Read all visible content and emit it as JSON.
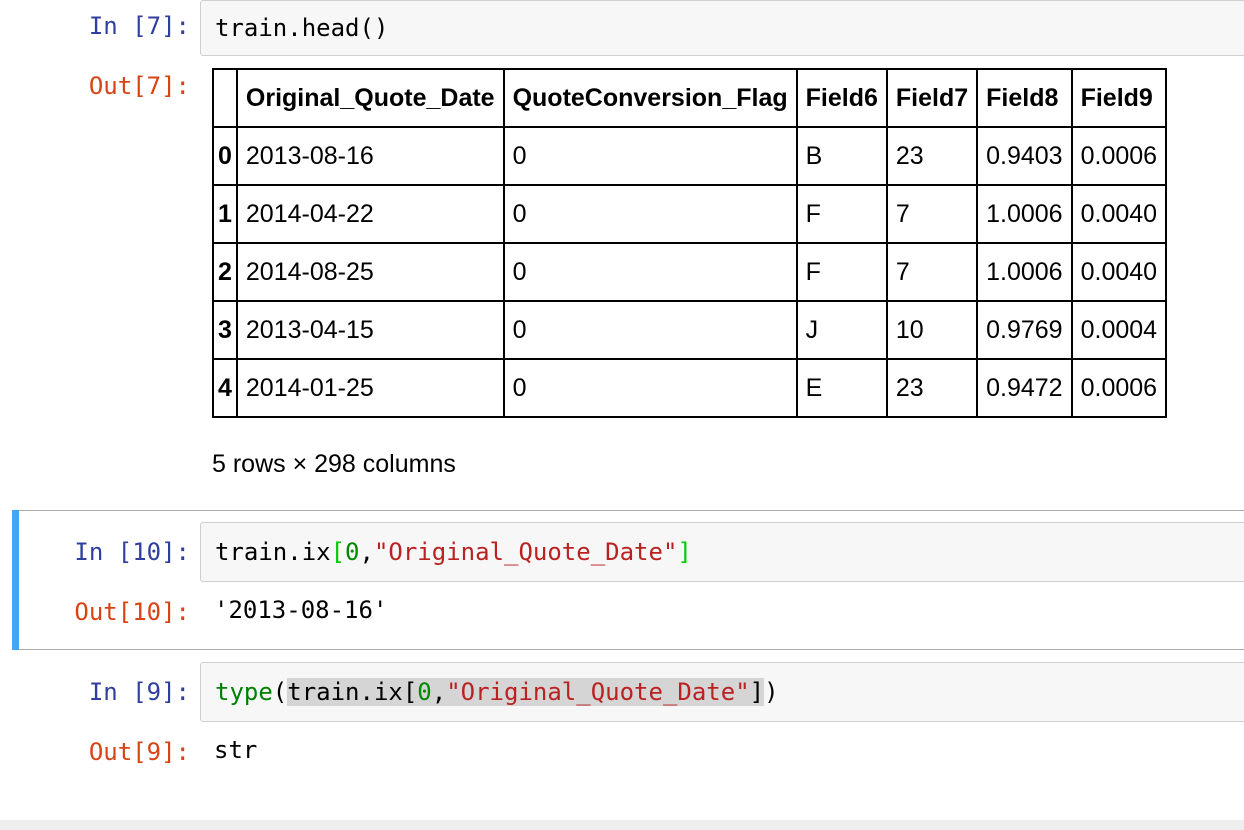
{
  "cells": [
    {
      "in_prompt": "In [7]:",
      "code": "train.head()",
      "out_prompt": "Out[7]:"
    },
    {
      "in_prompt": "In [10]:",
      "out_prompt": "Out[10]:",
      "output": "'2013-08-16'"
    },
    {
      "in_prompt": "In [9]:",
      "out_prompt": "Out[9]:",
      "output": "str"
    }
  ],
  "code_tokens": {
    "c2_var": "train.ix",
    "c2_open": "[",
    "c2_num": "0",
    "c2_comma": ",",
    "c2_str": "\"Original_Quote_Date\"",
    "c2_close": "]",
    "c3_kw": "type",
    "c3_paren_open": "(",
    "c3_var": "train.ix[",
    "c3_num": "0",
    "c3_comma": ",",
    "c3_str": "\"Original_Quote_Date\"",
    "c3_brk": "]",
    "c3_paren_close": ")"
  },
  "dataframe": {
    "columns": [
      "",
      "Original_Quote_Date",
      "QuoteConversion_Flag",
      "Field6",
      "Field7",
      "Field8",
      "Field9"
    ],
    "rows": [
      [
        "0",
        "2013-08-16",
        "0",
        "B",
        "23",
        "0.9403",
        "0.0006"
      ],
      [
        "1",
        "2014-04-22",
        "0",
        "F",
        "7",
        "1.0006",
        "0.0040"
      ],
      [
        "2",
        "2014-08-25",
        "0",
        "F",
        "7",
        "1.0006",
        "0.0040"
      ],
      [
        "3",
        "2013-04-15",
        "0",
        "J",
        "10",
        "0.9769",
        "0.0004"
      ],
      [
        "4",
        "2014-01-25",
        "0",
        "E",
        "23",
        "0.9472",
        "0.0006"
      ]
    ],
    "shape_text": "5 rows × 298 columns"
  },
  "colors": {
    "in_prompt": "#303f9f",
    "out_prompt": "#d84315",
    "selected_bar": "#42a5f5",
    "string": "#ba2121",
    "keyword": "#008000"
  }
}
